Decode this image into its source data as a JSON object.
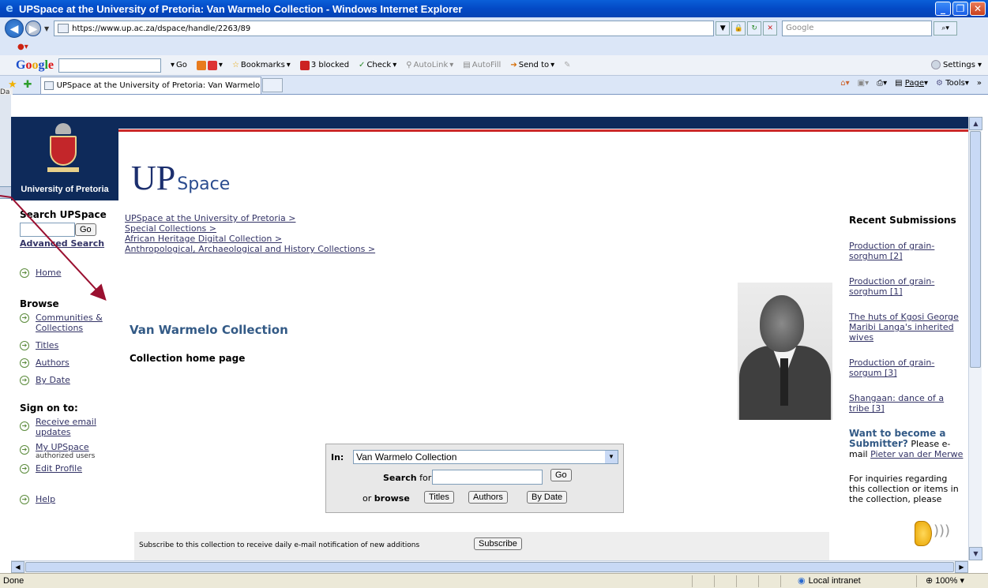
{
  "window": {
    "title": "UPSpace at the University of Pretoria: Van Warmelo Collection - Windows Internet Explorer"
  },
  "address": {
    "url": "https://www.up.ac.za/dspace/handle/2263/89",
    "search_placeholder": "Google"
  },
  "google_toolbar": {
    "go": "Go",
    "bookmarks": "Bookmarks",
    "blocked": "3 blocked",
    "check": "Check",
    "autolink": "AutoLink",
    "autofill": "AutoFill",
    "send_to": "Send to",
    "settings": "Settings"
  },
  "tabs": [
    {
      "label": "UPSpace at the University of Pretoria: Van Warmelo C..."
    }
  ],
  "command_bar": {
    "page": "Page",
    "tools": "Tools"
  },
  "left_edge_label": "Da",
  "header": {
    "university": "University of Pretoria",
    "wordmark_up": "UP",
    "wordmark_space": "Space"
  },
  "sidebar": {
    "search_title": "Search UPSpace",
    "go": "Go",
    "advanced_search": "Advanced Search",
    "home": "Home",
    "browse_title": "Browse",
    "browse_items": [
      "Communities & Collections",
      "Titles",
      "Authors",
      "By Date"
    ],
    "signon_title": "Sign on to:",
    "receive_email": "Receive email updates",
    "my_upspace": "My UPSpace",
    "my_upspace_sub": "authorized users",
    "edit_profile": "Edit Profile",
    "help": "Help"
  },
  "breadcrumbs": [
    "UPSpace at the University of Pretoria >",
    "Special Collections >",
    "African Heritage Digital Collection >",
    "Anthropological, Archaeological and History Collections >"
  ],
  "main": {
    "collection_title": "Van Warmelo Collection",
    "collection_subtitle": "Collection home page",
    "search": {
      "in_label": "In:",
      "scope_value": "Van Warmelo Collection",
      "search_label": "Search",
      "for_label": "for",
      "go": "Go",
      "or_label": "or",
      "browse_label": "browse",
      "titles": "Titles",
      "authors": "Authors",
      "by_date": "By Date"
    },
    "subscribe_text": "Subscribe to this collection to receive daily e-mail notification of new additions",
    "subscribe_button": "Subscribe"
  },
  "recent": {
    "title": "Recent Submissions",
    "items": [
      "Production of grain-sorghum [2]",
      "Production of grain-sorghum [1]",
      "The huts of Kgosi George Maribi Langa's inherited wives",
      "Production of grain-sorgum [3]",
      "Shangaan: dance of a tribe [3]"
    ],
    "want_title": "Want to become a Submitter?",
    "want_text": "Please e-mail",
    "contact_name": "Pieter van der Merwe",
    "inquiries_text": "For inquiries regarding this collection or items in the collection, please"
  },
  "status": {
    "text": "Done",
    "zone": "Local intranet",
    "zoom": "100%"
  },
  "colors": {
    "titlebar": "#0349c5",
    "up_navy": "#0e2a5a",
    "up_red": "#cc2a2a",
    "link": "#333366",
    "heading_blue": "#335a86"
  }
}
